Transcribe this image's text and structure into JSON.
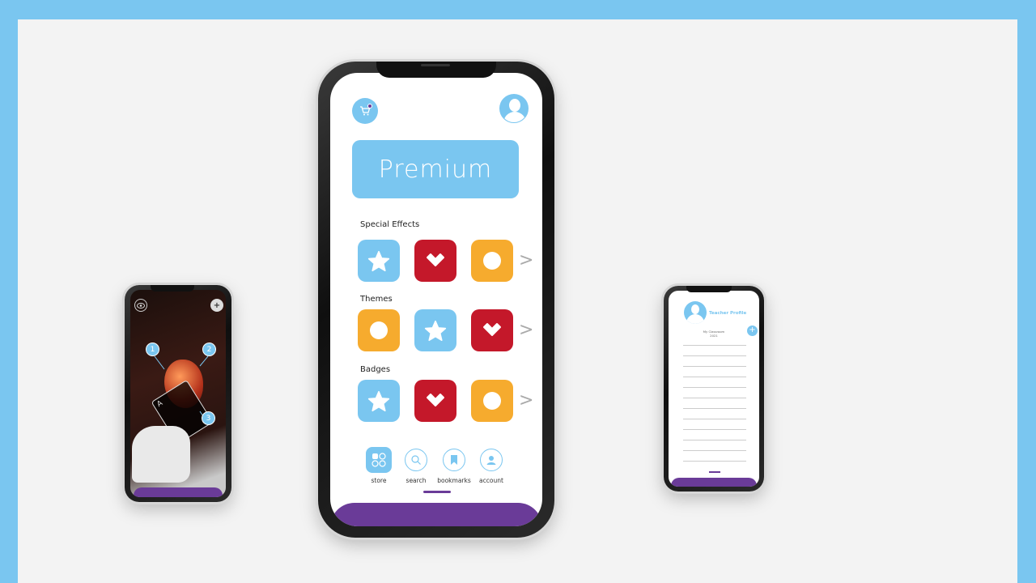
{
  "colors": {
    "outer_background": "#7ac6f0",
    "canvas_background": "#f3f3f3",
    "accent_blue": "#7ac6f0",
    "accent_red": "#c4182a",
    "accent_orange": "#f6ab2e",
    "accent_purple": "#6a3b98"
  },
  "main_phone": {
    "cart_icon": "cart-icon",
    "avatar_icon": "user-avatar-icon",
    "premium_label": "Premium",
    "sections": [
      {
        "label": "Special Effects",
        "tiles": [
          "star",
          "heart",
          "circle"
        ]
      },
      {
        "label": "Themes",
        "tiles": [
          "circle",
          "star",
          "heart"
        ]
      },
      {
        "label": "Badges",
        "tiles": [
          "star",
          "heart",
          "circle"
        ]
      }
    ],
    "nav": [
      {
        "label": "store",
        "icon": "store-icon",
        "active": true
      },
      {
        "label": "search",
        "icon": "search-icon",
        "active": false
      },
      {
        "label": "bookmarks",
        "icon": "bookmark-icon",
        "active": false
      },
      {
        "label": "account",
        "icon": "account-icon",
        "active": false
      }
    ]
  },
  "left_phone": {
    "icons": [
      "eye-icon",
      "plus-icon"
    ],
    "hotspots": [
      "1",
      "2",
      "3"
    ],
    "card_letter": "A"
  },
  "right_phone": {
    "title": "Teacher Profile",
    "class_label": "My Classroom",
    "class_sub": "2021"
  }
}
